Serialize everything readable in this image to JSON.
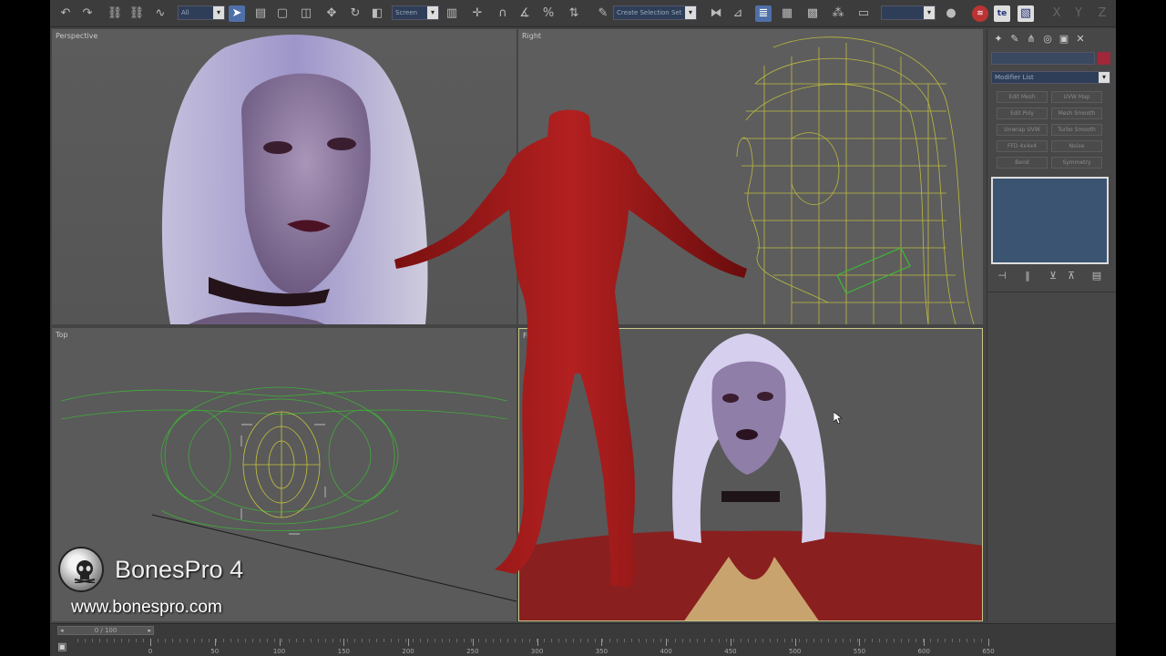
{
  "toolbar": {
    "selection_filter": "All",
    "ref_coord": "Screen",
    "named_sel": "Create Selection Set"
  },
  "viewports": {
    "perspective": "Perspective",
    "right": "Right",
    "top": "Top",
    "front": "Front"
  },
  "command_panel": {
    "modifier_list": "Modifier List",
    "modifier_buttons": [
      "Edit Mesh",
      "UVW Map",
      "Edit Poly",
      "Mesh Smooth",
      "Unwrap UVW",
      "Turbo Smooth",
      "FFD 4x4x4",
      "Noise",
      "Bend",
      "Symmetry"
    ]
  },
  "timeline": {
    "frame_display": "0 / 100",
    "ticks": [
      "0",
      "50",
      "100",
      "150",
      "200",
      "250",
      "300",
      "350",
      "400",
      "450",
      "500",
      "550",
      "600",
      "650"
    ]
  },
  "logo": {
    "title": "BonesPro 4",
    "url": "www.bonespro.com"
  },
  "colors": {
    "viewport_bg": "#5a5a5a",
    "active_border": "#c8c88a",
    "body_red": "#a01818",
    "wire_yellow": "#c8c43c",
    "wire_green": "#3cbb33",
    "stack_blue": "#3b5472"
  },
  "icons": [
    "undo-icon",
    "redo-icon",
    "select-icon",
    "move-icon",
    "rotate-icon",
    "scale-icon",
    "snap-icon",
    "mirror-icon",
    "align-icon",
    "render-icon",
    "material-editor-icon"
  ]
}
